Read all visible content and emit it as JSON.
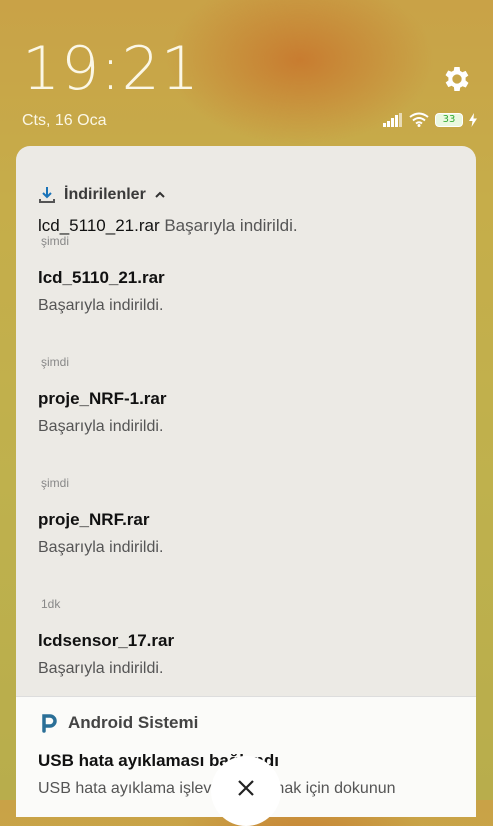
{
  "lockscreen": {
    "time": "19:21",
    "date": "Cts, 16 Oca",
    "battery": "33"
  },
  "downloads": {
    "app_name": "İndirilenler",
    "summary_title": "lcd_5110_21.rar",
    "summary_text": "Başarıyla indirildi.",
    "summary_time": "şimdi",
    "items": [
      {
        "title": "lcd_5110_21.rar",
        "text": "Başarıyla indirildi."
      },
      {
        "time": "şimdi",
        "title": "proje_NRF-1.rar",
        "text": "Başarıyla indirildi."
      },
      {
        "time": "şimdi",
        "title": "proje_NRF.rar",
        "text": "Başarıyla indirildi."
      },
      {
        "time": "1dk",
        "title": "lcdsensor_17.rar",
        "text": "Başarıyla indirildi."
      }
    ]
  },
  "system": {
    "app_name": "Android Sistemi",
    "title": "USB hata ayıklaması bağlandı",
    "text": "USB hata ayıklama işlevini kapatmak için dokunun"
  }
}
